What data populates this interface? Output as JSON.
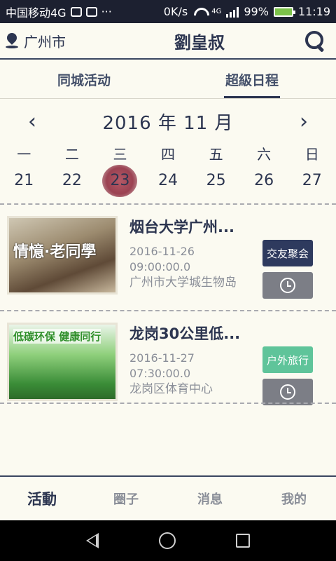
{
  "status_bar": {
    "carrier": "中国移动4G",
    "more": "···",
    "speed": "0K/s",
    "network": "4G",
    "battery": "99%",
    "time": "11:19"
  },
  "header": {
    "city": "广州市",
    "brand": "劉皇叔",
    "icons": [
      "location-pin-icon",
      "search-icon"
    ]
  },
  "tabs": [
    {
      "label": "同城活动",
      "active": false
    },
    {
      "label": "超級日程",
      "active": true
    }
  ],
  "calendar": {
    "month_label": "2016 年 11 月",
    "weekdays": [
      "一",
      "二",
      "三",
      "四",
      "五",
      "六",
      "日"
    ],
    "days": [
      "21",
      "22",
      "23",
      "24",
      "25",
      "26",
      "27"
    ],
    "selected_day": "23"
  },
  "events": [
    {
      "title": "烟台大学广州...",
      "date": "2016-11-26",
      "time": "09:00:00.0",
      "place": "广州市大学城生物岛",
      "tag": "交友聚会",
      "tag_color": "#2e3a5e",
      "thumb_text": "情憶·老同學"
    },
    {
      "title": "龙岗30公里低...",
      "date": "2016-11-27",
      "time": "07:30:00.0",
      "place": "龙岗区体育中心",
      "tag": "户外旅行",
      "tag_color": "#5fc49a",
      "thumb_text": "低碳环保 健康同行"
    }
  ],
  "bottom_nav": [
    {
      "label": "活動",
      "active": true
    },
    {
      "label": "圈子",
      "active": false
    },
    {
      "label": "消息",
      "active": false
    },
    {
      "label": "我的",
      "active": false
    }
  ],
  "colors": {
    "primary": "#2c3550",
    "background": "#fbfaf1",
    "muted": "#8a8e98",
    "alarm_button": "#7c7e86"
  }
}
